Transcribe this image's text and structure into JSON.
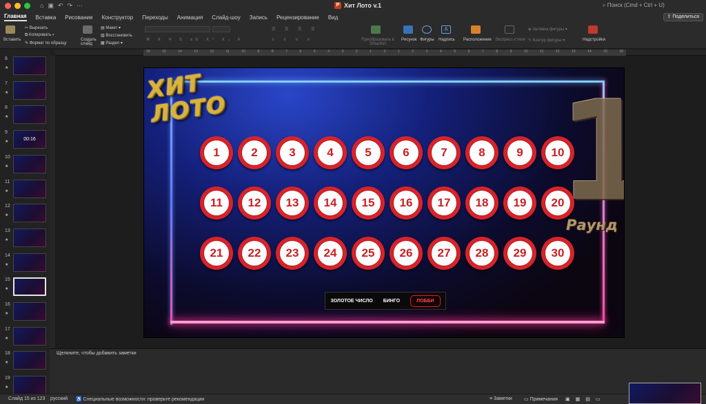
{
  "window": {
    "title": "Хит Лото v.1",
    "search": "Поиск (Cmd + Ctrl + U)",
    "share_label": "Поделиться",
    "doc_icon": "P"
  },
  "tabs": [
    "Главная",
    "Вставка",
    "Рисование",
    "Конструктор",
    "Переходы",
    "Анимация",
    "Слайд-шоу",
    "Запись",
    "Рецензирование",
    "Вид"
  ],
  "ribbon": {
    "paste": "Вставить",
    "cut": "Вырезать",
    "copy": "Копировать",
    "format_painter": "Формат по образцу",
    "new_slide": "Создать слайд",
    "layout": "Макет",
    "reset": "Восстановить",
    "section": "Раздел",
    "smartart": "Преобразовать в SmartArt",
    "picture": "Рисунок",
    "shapes": "Фигуры",
    "textbox": "Надпись",
    "arrange": "Расположение",
    "quick_styles": "Экспресс-стили",
    "shape_fill": "Заливка фигуры",
    "shape_outline": "Контур фигуры",
    "addins": "Надстройки",
    "ruler_ticks": [
      "16",
      "15",
      "14",
      "13",
      "12",
      "11",
      "10",
      "9",
      "8",
      "7",
      "6",
      "5",
      "4",
      "3",
      "2",
      "1",
      "0",
      "1",
      "2",
      "3",
      "4",
      "5",
      "6",
      "7",
      "8",
      "9",
      "10",
      "11",
      "12",
      "13",
      "14",
      "15",
      "16"
    ]
  },
  "thumbnails": [
    {
      "num": "6",
      "label": ""
    },
    {
      "num": "7",
      "label": ""
    },
    {
      "num": "8",
      "label": ""
    },
    {
      "num": "9",
      "label": "00:16"
    },
    {
      "num": "10",
      "label": ""
    },
    {
      "num": "11",
      "label": ""
    },
    {
      "num": "12",
      "label": ""
    },
    {
      "num": "13",
      "label": ""
    },
    {
      "num": "14",
      "label": ""
    },
    {
      "num": "15",
      "label": ""
    },
    {
      "num": "16",
      "label": ""
    },
    {
      "num": "17",
      "label": ""
    },
    {
      "num": "18",
      "label": ""
    },
    {
      "num": "19",
      "label": ""
    }
  ],
  "slide": {
    "logo_line1": "ХИТ",
    "logo_line2": "ЛОТО",
    "round_number": "1",
    "round_label": "Раунд",
    "numbers": [
      "1",
      "2",
      "3",
      "4",
      "5",
      "6",
      "7",
      "8",
      "9",
      "10",
      "11",
      "12",
      "13",
      "14",
      "15",
      "16",
      "17",
      "18",
      "19",
      "20",
      "21",
      "22",
      "23",
      "24",
      "25",
      "26",
      "27",
      "28",
      "29",
      "30"
    ],
    "menu": {
      "golden": "ЗОЛОТОЕ ЧИСЛО",
      "bingo": "БИНГО",
      "lobby": "ЛОББИ"
    }
  },
  "notes_placeholder": "Щелкните, чтобы добавить заметки",
  "status": {
    "slide_pos": "Слайд 15 из 123",
    "language": "русский",
    "accessibility": "Специальные возможности: проверьте рекомендации",
    "notes": "Заметки",
    "comments": "Примечания"
  },
  "colors": {
    "ball_red": "#d8232a",
    "lobby_red": "#e11d29",
    "neon_blue": "#87ccff",
    "neon_pink": "#ff3fa0"
  }
}
